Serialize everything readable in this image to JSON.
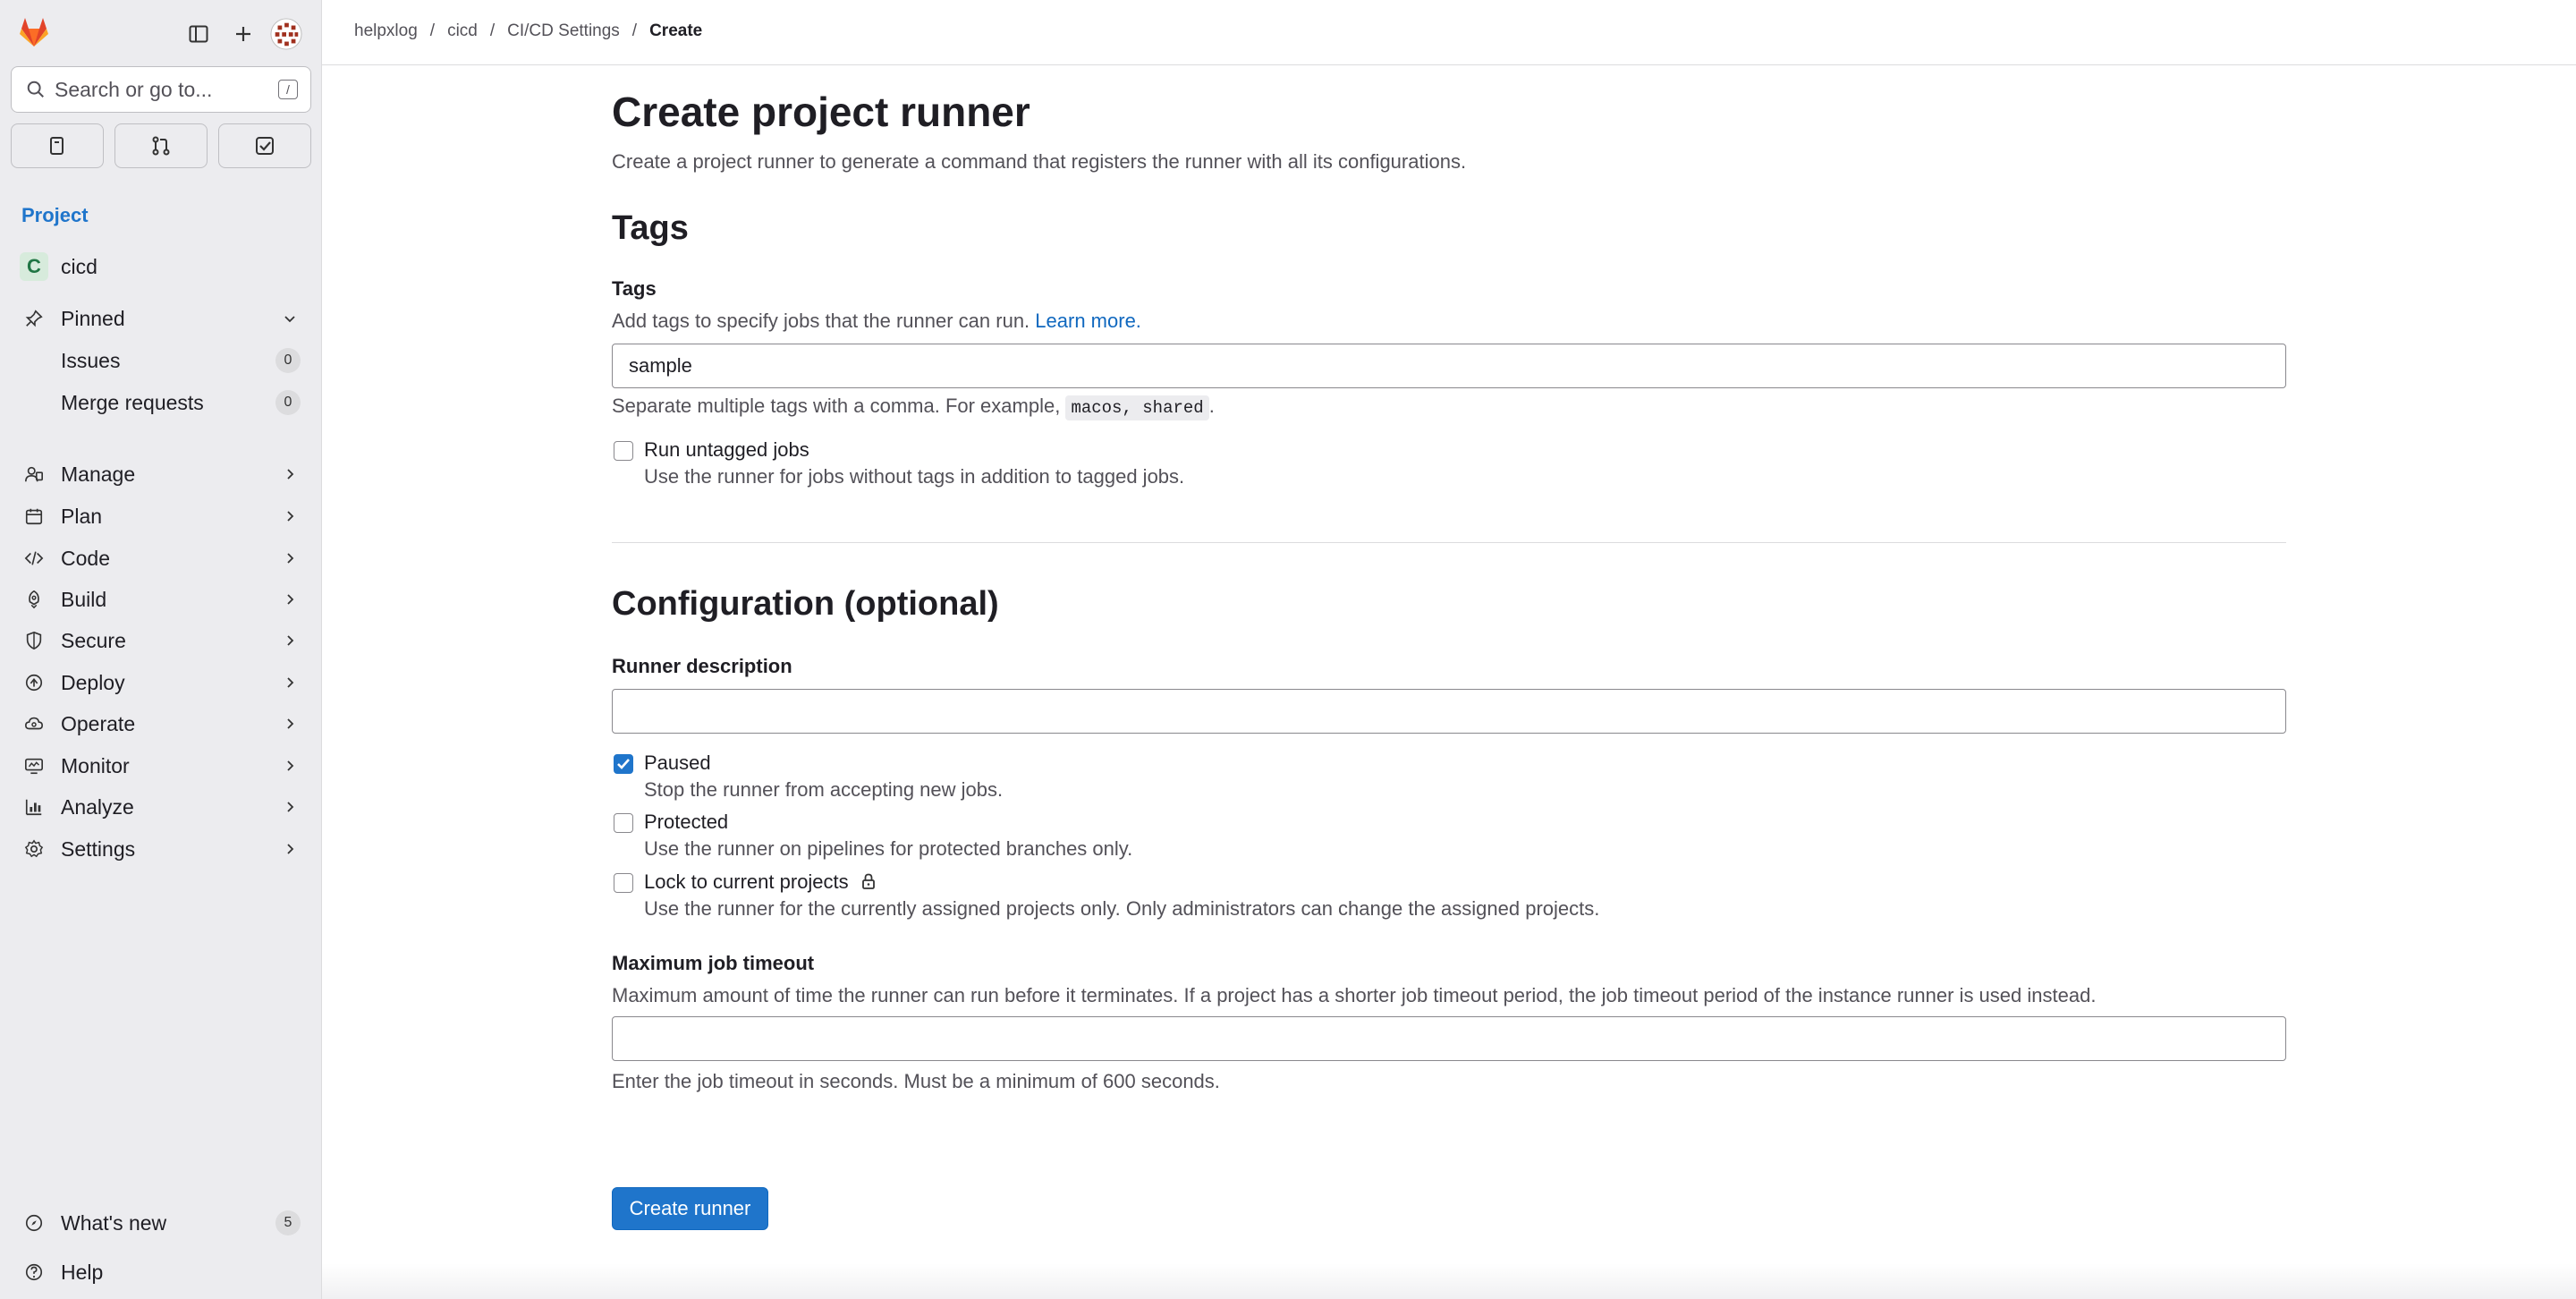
{
  "sidebar": {
    "search_placeholder": "Search or go to...",
    "search_shortcut": "/",
    "section_label": "Project",
    "project": {
      "initial": "C",
      "name": "cicd"
    },
    "pinned": {
      "label": "Pinned",
      "items": [
        {
          "label": "Issues",
          "count": "0"
        },
        {
          "label": "Merge requests",
          "count": "0"
        }
      ]
    },
    "nav": [
      "Manage",
      "Plan",
      "Code",
      "Build",
      "Secure",
      "Deploy",
      "Operate",
      "Monitor",
      "Analyze",
      "Settings"
    ],
    "whats_new": {
      "label": "What's new",
      "count": "5"
    },
    "help": "Help"
  },
  "breadcrumb": [
    "helpxlog",
    "cicd",
    "CI/CD Settings",
    "Create"
  ],
  "page": {
    "title": "Create project runner",
    "description": "Create a project runner to generate a command that registers the runner with all its configurations.",
    "tags_section": {
      "heading": "Tags",
      "label": "Tags",
      "help_prefix": "Add tags to specify jobs that the runner can run.",
      "help_link": "Learn more.",
      "value": "sample",
      "hint_prefix": "Separate multiple tags with a comma. For example,",
      "hint_code": "macos, shared",
      "hint_suffix": ".",
      "untagged": {
        "label": "Run untagged jobs",
        "help": "Use the runner for jobs without tags in addition to tagged jobs.",
        "checked": false
      }
    },
    "config_section": {
      "heading": "Configuration (optional)",
      "description_label": "Runner description",
      "description_value": "",
      "paused": {
        "label": "Paused",
        "help": "Stop the runner from accepting new jobs.",
        "checked": true
      },
      "protected": {
        "label": "Protected",
        "help": "Use the runner on pipelines for protected branches only.",
        "checked": false
      },
      "locked": {
        "label": "Lock to current projects",
        "help": "Use the runner for the currently assigned projects only. Only administrators can change the assigned projects.",
        "checked": false
      },
      "timeout_label": "Maximum job timeout",
      "timeout_help": "Maximum amount of time the runner can run before it terminates. If a project has a shorter job timeout period, the job timeout period of the instance runner is used instead.",
      "timeout_value": "",
      "timeout_hint": "Enter the job timeout in seconds. Must be a minimum of 600 seconds."
    },
    "submit_label": "Create runner"
  }
}
